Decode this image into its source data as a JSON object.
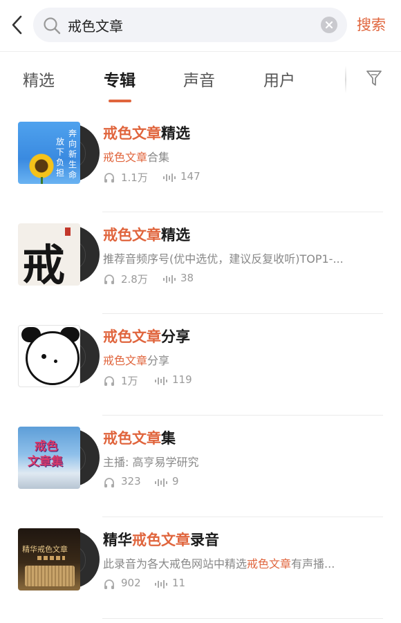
{
  "header": {
    "search_value": "戒色文章",
    "search_button": "搜索"
  },
  "tabs": [
    {
      "label": "精选",
      "active": false
    },
    {
      "label": "专辑",
      "active": true
    },
    {
      "label": "声音",
      "active": false
    },
    {
      "label": "用户",
      "active": false
    }
  ],
  "accent_color": "#e0653d",
  "albums": [
    {
      "title_parts": [
        {
          "text": "戒色文章",
          "hl": true
        },
        {
          "text": "精选",
          "hl": false
        }
      ],
      "subtitle_parts": [
        {
          "text": "戒色文章",
          "hl": true
        },
        {
          "text": "合集",
          "hl": false
        }
      ],
      "plays": "1.1万",
      "tracks": "147",
      "cover_text": [
        "奔",
        "向",
        "新",
        "生",
        "命",
        "放",
        "下",
        "负",
        "担"
      ]
    },
    {
      "title_parts": [
        {
          "text": "戒色文章",
          "hl": true
        },
        {
          "text": "精选",
          "hl": false
        }
      ],
      "subtitle_parts": [
        {
          "text": "推荐音频序号(优中选优，建议反复收听)TOP1-...",
          "hl": false
        }
      ],
      "plays": "2.8万",
      "tracks": "38",
      "cover_text": [
        "戒"
      ]
    },
    {
      "title_parts": [
        {
          "text": "戒色文章",
          "hl": true
        },
        {
          "text": "分享",
          "hl": false
        }
      ],
      "subtitle_parts": [
        {
          "text": "戒色文章",
          "hl": true
        },
        {
          "text": "分享",
          "hl": false
        }
      ],
      "plays": "1万",
      "tracks": "119",
      "cover_text": []
    },
    {
      "title_parts": [
        {
          "text": "戒色文章",
          "hl": true
        },
        {
          "text": "集",
          "hl": false
        }
      ],
      "subtitle_parts": [
        {
          "text": "主播: 高亨易学研究",
          "hl": false
        }
      ],
      "plays": "323",
      "tracks": "9",
      "cover_text": [
        "戒色",
        "文章集"
      ]
    },
    {
      "title_parts": [
        {
          "text": "精华",
          "hl": false
        },
        {
          "text": "戒色文章",
          "hl": true
        },
        {
          "text": "录音",
          "hl": false
        }
      ],
      "subtitle_parts": [
        {
          "text": "此录音为各大戒色网站中精选",
          "hl": false
        },
        {
          "text": "戒色文章",
          "hl": true
        },
        {
          "text": "有声播...",
          "hl": false
        }
      ],
      "plays": "902",
      "tracks": "11",
      "cover_text": [
        "精华戒色文章"
      ]
    }
  ]
}
